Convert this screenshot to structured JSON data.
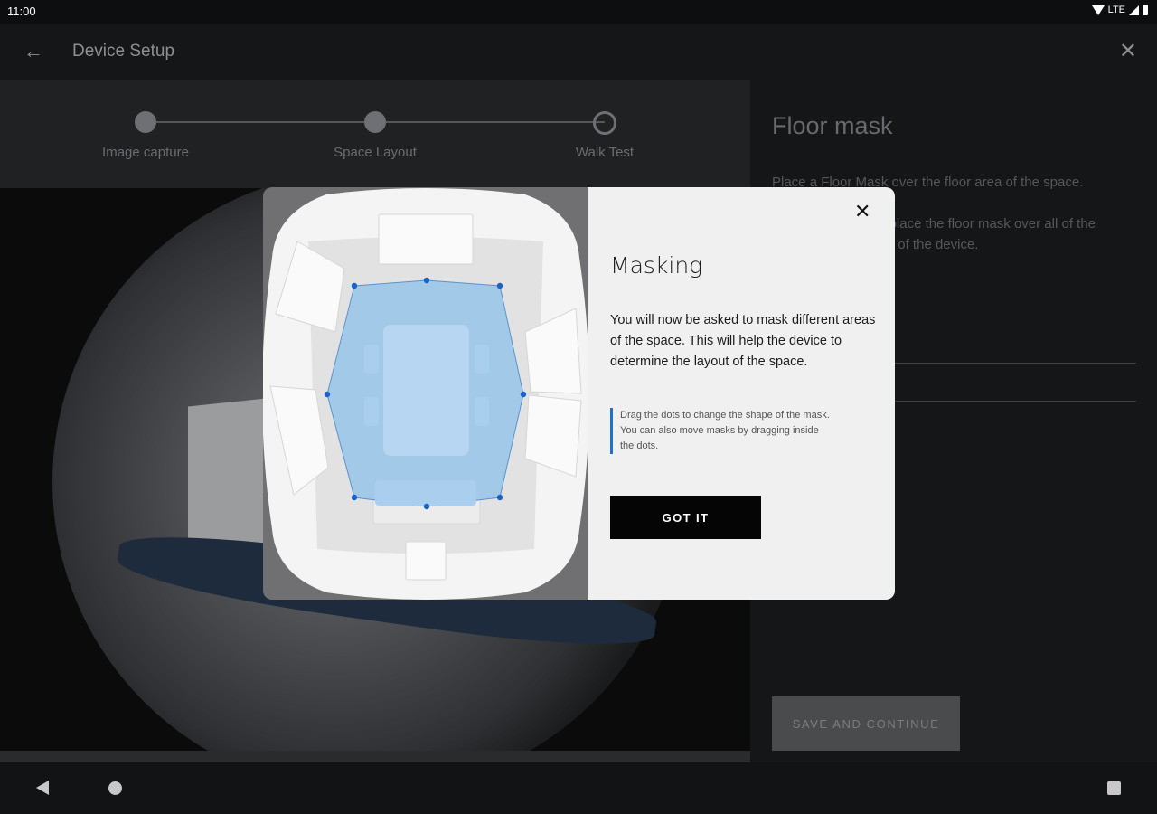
{
  "status_bar": {
    "time": "11:00",
    "network": "LTE"
  },
  "app_bar": {
    "title": "Device Setup"
  },
  "stepper": {
    "steps": [
      {
        "label": "Image capture",
        "state": "done"
      },
      {
        "label": "Space Layout",
        "state": "done"
      },
      {
        "label": "Walk Test",
        "state": "pending"
      }
    ]
  },
  "panel": {
    "title": "Floor mask",
    "text_1": "Place a Floor Mask over the floor area of the space.",
    "text_2": "You do not need to place the floor mask over all of the space, only the area of the device.",
    "save_label": "SAVE AND CONTINUE"
  },
  "modal": {
    "title": "Masking",
    "body": "You will now be asked to mask different areas of the space. This will help the device to determine the layout of the space.",
    "hint": "Drag the dots to change the shape of the mask. You can also move masks by dragging inside the dots.",
    "button_label": "GOT IT"
  },
  "colors": {
    "accent_blue": "#1e6fd6",
    "mask_fill": "#9cc6ea",
    "modal_bg": "#f0f0f0"
  }
}
